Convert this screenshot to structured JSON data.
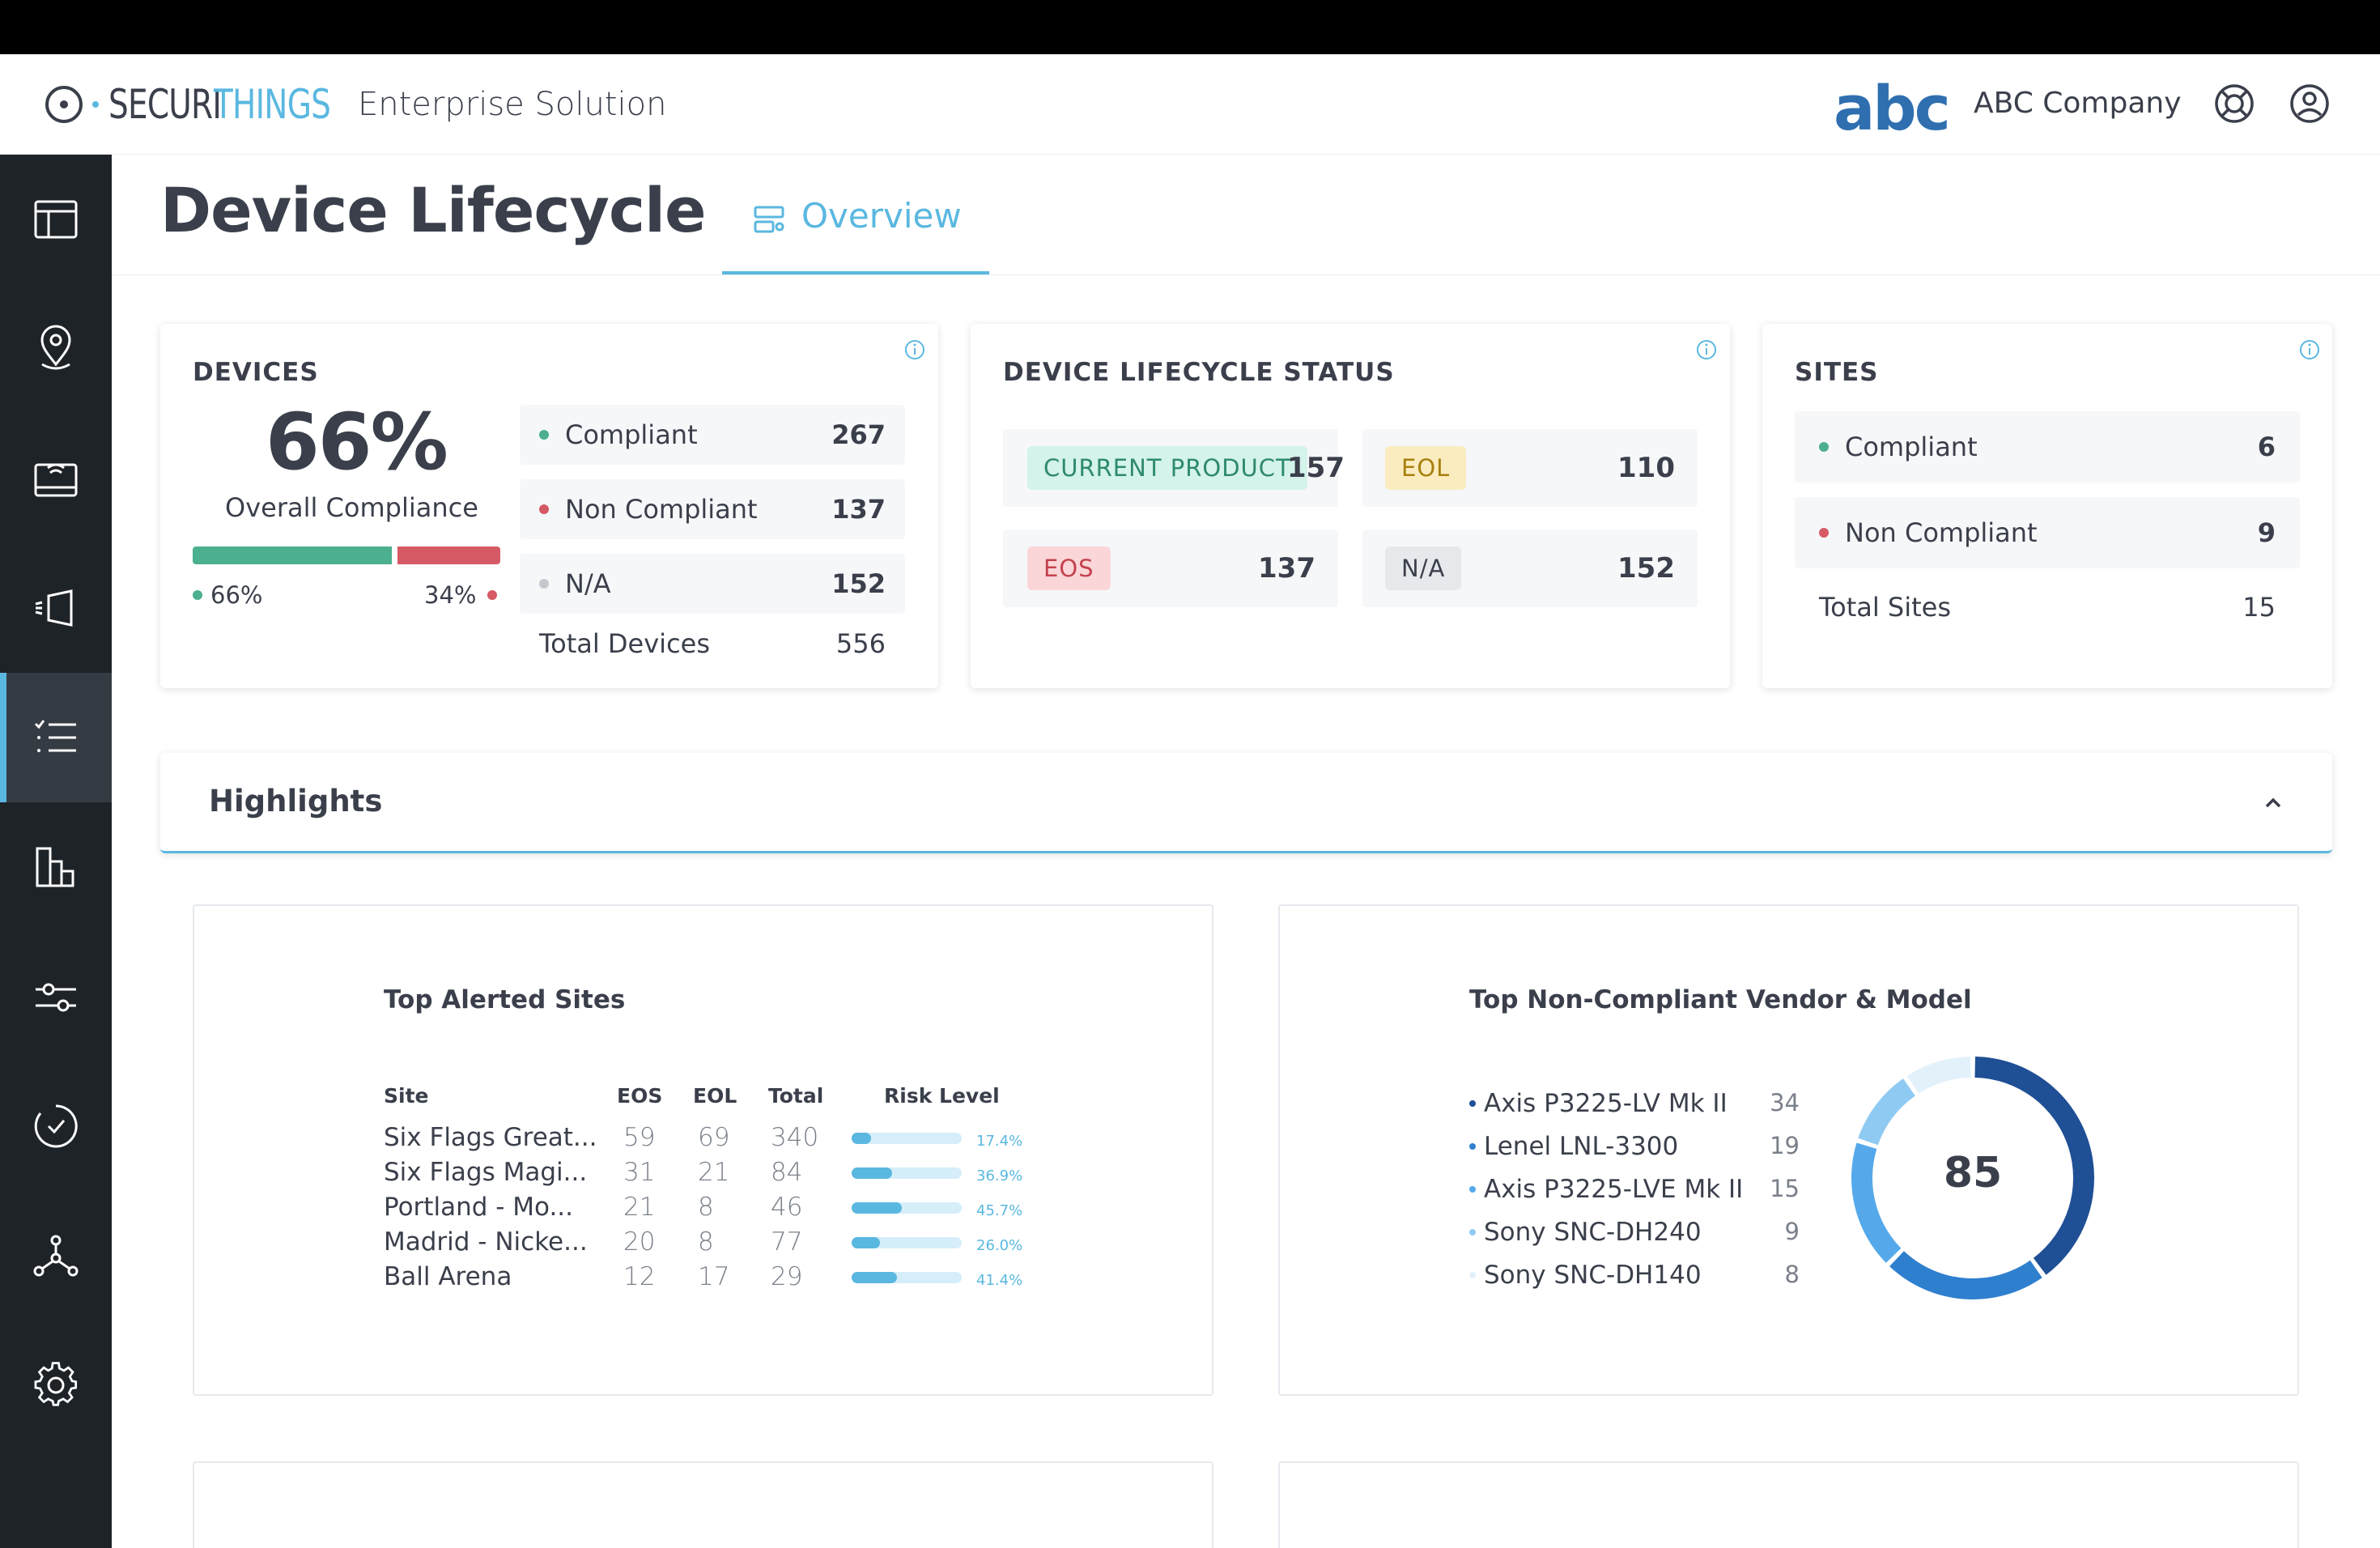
{
  "header": {
    "logo_part1": "SECURI",
    "logo_part2": "THINGS",
    "product": "Enterprise Solution",
    "brand_mark": "abc",
    "company": "ABC Company",
    "icons": [
      "support-icon",
      "user-icon"
    ]
  },
  "sidebar": {
    "items": [
      {
        "name": "dashboard-icon",
        "active": false
      },
      {
        "name": "location-pin-icon",
        "active": false
      },
      {
        "name": "device-icon",
        "active": false
      },
      {
        "name": "camera-icon",
        "active": false
      },
      {
        "name": "checklist-icon",
        "active": true
      },
      {
        "name": "reports-icon",
        "active": false
      },
      {
        "name": "sliders-icon",
        "active": false
      },
      {
        "name": "refresh-check-icon",
        "active": false
      },
      {
        "name": "network-icon",
        "active": false
      },
      {
        "name": "gear-icon",
        "active": false
      }
    ]
  },
  "page": {
    "title": "Device Lifecycle",
    "tab": "Overview"
  },
  "devices": {
    "title": "DEVICES",
    "percent": "66%",
    "subtitle": "Overall Compliance",
    "compliant_share": 0.66,
    "left_label": "66%",
    "right_label": "34%",
    "rows": [
      {
        "label": "Compliant",
        "value": "267",
        "color": "#4caf8f"
      },
      {
        "label": "Non Compliant",
        "value": "137",
        "color": "#d65a66"
      },
      {
        "label": "N/A",
        "value": "152",
        "color": "#c5c9cf"
      }
    ],
    "total_label": "Total Devices",
    "total_value": "556"
  },
  "lifecycle": {
    "title": "DEVICE LIFECYCLE STATUS",
    "items": [
      {
        "label": "CURRENT PRODUCT",
        "value": "157",
        "bg": "#d4f3ea",
        "fg": "#2e8a6c"
      },
      {
        "label": "EOL",
        "value": "110",
        "bg": "#fbecc0",
        "fg": "#a8800f"
      },
      {
        "label": "EOS",
        "value": "137",
        "bg": "#fbd6d8",
        "fg": "#c4424e"
      },
      {
        "label": "N/A",
        "value": "152",
        "bg": "#e6e8eb",
        "fg": "#3a3f4b"
      }
    ]
  },
  "sites": {
    "title": "SITES",
    "rows": [
      {
        "label": "Compliant",
        "value": "6",
        "color": "#4caf8f"
      },
      {
        "label": "Non Compliant",
        "value": "9",
        "color": "#d65a66"
      }
    ],
    "total_label": "Total Sites",
    "total_value": "15"
  },
  "highlights": {
    "title": "Highlights"
  },
  "top_alerted": {
    "title": "Top Alerted Sites",
    "headers": [
      "Site",
      "EOS",
      "EOL",
      "Total",
      "Risk Level"
    ],
    "rows": [
      {
        "site": "Six Flags Great...",
        "eos": "59",
        "eol": "69",
        "total": "340",
        "risk": 17.4,
        "risk_label": "17.4%"
      },
      {
        "site": "Six Flags Magi...",
        "eos": "31",
        "eol": "21",
        "total": "84",
        "risk": 36.9,
        "risk_label": "36.9%"
      },
      {
        "site": "Portland - Mo...",
        "eos": "21",
        "eol": "8",
        "total": "46",
        "risk": 45.7,
        "risk_label": "45.7%"
      },
      {
        "site": "Madrid - Nicke...",
        "eos": "20",
        "eol": "8",
        "total": "77",
        "risk": 26.0,
        "risk_label": "26.0%"
      },
      {
        "site": "Ball Arena",
        "eos": "12",
        "eol": "17",
        "total": "29",
        "risk": 41.4,
        "risk_label": "41.4%"
      }
    ]
  },
  "top_vendor": {
    "title": "Top Non-Compliant Vendor & Model",
    "total": "85",
    "items": [
      {
        "name": "Axis P3225-LV Mk II",
        "count": 34,
        "color": "#1f4f95"
      },
      {
        "name": "Lenel LNL-3300",
        "count": 19,
        "color": "#2f7fcf"
      },
      {
        "name": "Axis P3225-LVE Mk II",
        "count": 15,
        "color": "#55a9ea"
      },
      {
        "name": "Sony SNC-DH240",
        "count": 9,
        "color": "#8fcaf3"
      },
      {
        "name": "Sony SNC-DH140",
        "count": 8,
        "color": "#e3f1fb"
      }
    ]
  }
}
